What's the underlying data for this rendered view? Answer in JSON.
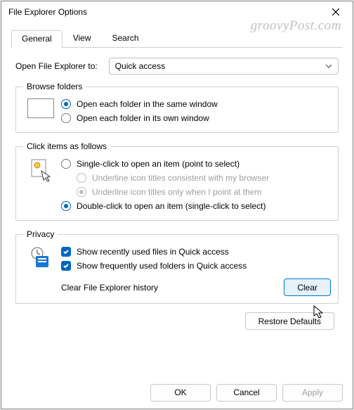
{
  "title": "File Explorer Options",
  "watermark": "groovyPost.com",
  "tabs": {
    "general": "General",
    "view": "View",
    "search": "Search"
  },
  "open_to": {
    "label": "Open File Explorer to:",
    "value": "Quick access"
  },
  "browse": {
    "legend": "Browse folders",
    "same": "Open each folder in the same window",
    "own": "Open each folder in its own window"
  },
  "click": {
    "legend": "Click items as follows",
    "single": "Single-click to open an item (point to select)",
    "u1": "Underline icon titles consistent with my browser",
    "u2": "Underline icon titles only when I point at them",
    "double": "Double-click to open an item (single-click to select)"
  },
  "privacy": {
    "legend": "Privacy",
    "recent": "Show recently used files in Quick access",
    "freq": "Show frequently used folders in Quick access",
    "clear_label": "Clear File Explorer history",
    "clear_btn": "Clear"
  },
  "restore": "Restore Defaults",
  "footer": {
    "ok": "OK",
    "cancel": "Cancel",
    "apply": "Apply"
  }
}
